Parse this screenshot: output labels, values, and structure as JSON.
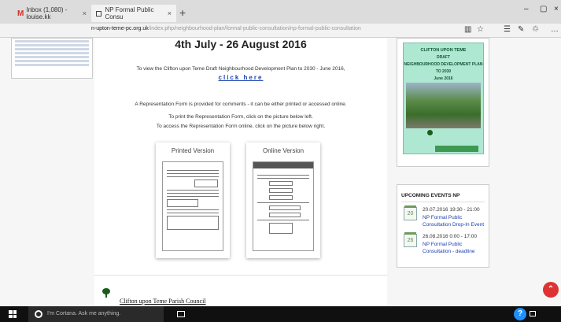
{
  "browser": {
    "tabs": [
      {
        "label": "Inbox (1,080) - louise.kk",
        "icon": "gmail-icon"
      },
      {
        "label": "NP Formal Public Consu",
        "icon": "page-icon"
      }
    ],
    "tab_close": "×",
    "new_tab": "+",
    "window_controls": {
      "minimize": "–",
      "maximize": "▢",
      "close": "×"
    },
    "url_host": "n-upton-teme-pc.org.uk",
    "url_path": "/index.php/neighbourhood-plan/formal-public-consultation/np-formal-public-consultation",
    "toolbar_icons": {
      "reading": "▥",
      "favorite": "☆",
      "hub": "☰",
      "note": "✎",
      "share": "♲",
      "more": "…"
    }
  },
  "content": {
    "date_heading": "4th July - 26 August 2016",
    "view_text": "To view the Clifton upon Teme Draft Neighbourhood Development Plan to 2030 - June 2016,",
    "click_here": "click here",
    "rep_form_text": "A Representation Form is provided for comments - it can be either printed or accessed online.",
    "print_text": "To print the Representation Form, click on the picture below left.",
    "online_text": "To access the Representation Form online, click on the picture below right.",
    "printed_version": "Printed Version",
    "online_version": "Online Version",
    "footer_link": "Clifton upon Teme Parish Council"
  },
  "plan_cover": {
    "title": "CLIFTON UPON TEME",
    "sub1": "DRAFT",
    "sub2": "NEIGHBOURHOOD DEVELOPMENT PLAN",
    "sub3": "TO 2030",
    "sub4": "June 2016"
  },
  "events": {
    "heading": "UPCOMING EVENTS NP",
    "items": [
      {
        "date": "20.07.2016 19:30 - 21:00",
        "title": "NP Formal Public Consultation Drop-In Event",
        "day": "20"
      },
      {
        "date": "26.08.2016 0:00 - 17:00",
        "title": "NP Formal Public Consultation - deadline",
        "day": "26"
      }
    ]
  },
  "scroll_top": "⌃",
  "taskbar": {
    "search_placeholder": "I'm Cortana. Ask me anything.",
    "help": "?"
  },
  "colors": {
    "link": "#1a3fb0",
    "cover_bg": "#aee7d2",
    "scroll_top_bg": "#dd3333",
    "taskbar_bg": "#101010"
  }
}
